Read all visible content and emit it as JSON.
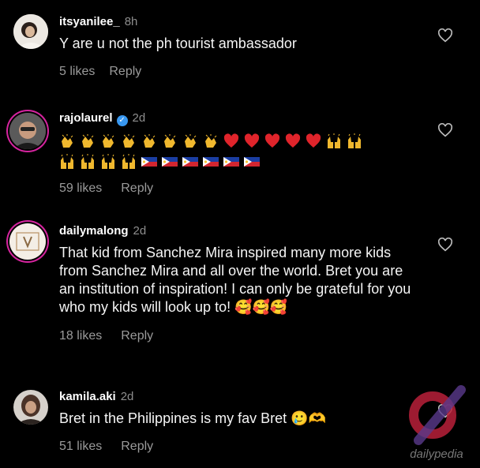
{
  "comments": [
    {
      "username": "itsyanilee_",
      "time": "8h",
      "text": "Y are u not the ph tourist ambassador",
      "likes": "5 likes",
      "reply": "Reply"
    },
    {
      "username": "rajolaurel",
      "verified": true,
      "time": "2d",
      "text_emoji": [
        [
          "clapping-hands",
          "clapping-hands",
          "clapping-hands",
          "clapping-hands",
          "clapping-hands",
          "clapping-hands",
          "clapping-hands",
          "clapping-hands",
          "red-heart",
          "red-heart",
          "red-heart",
          "red-heart",
          "red-heart",
          "raising-hands",
          "raising-hands"
        ],
        [
          "raising-hands",
          "raising-hands",
          "raising-hands",
          "raising-hands",
          "philippines-flag",
          "philippines-flag",
          "philippines-flag",
          "philippines-flag",
          "philippines-flag",
          "philippines-flag"
        ]
      ],
      "likes": "59 likes",
      "reply": "Reply"
    },
    {
      "username": "dailymalong",
      "time": "2d",
      "text": "That kid from Sanchez Mira inspired many more kids from Sanchez Mira and all over the world. Bret you are an institution of inspiration!  I can only be grateful for you who my kids will look up to! 🥰🥰🥰",
      "likes": "18 likes",
      "reply": "Reply"
    },
    {
      "username": "kamila.aki",
      "time": "2d",
      "text": "Bret in the Philippines is my fav Bret 🥲🫶",
      "likes": "51 likes",
      "reply": "Reply"
    }
  ],
  "watermark": "dailypedia",
  "colors": {
    "background": "#000000",
    "muted": "#8e8e8e",
    "verified": "#3897f0",
    "watermark": "#b8203a"
  }
}
